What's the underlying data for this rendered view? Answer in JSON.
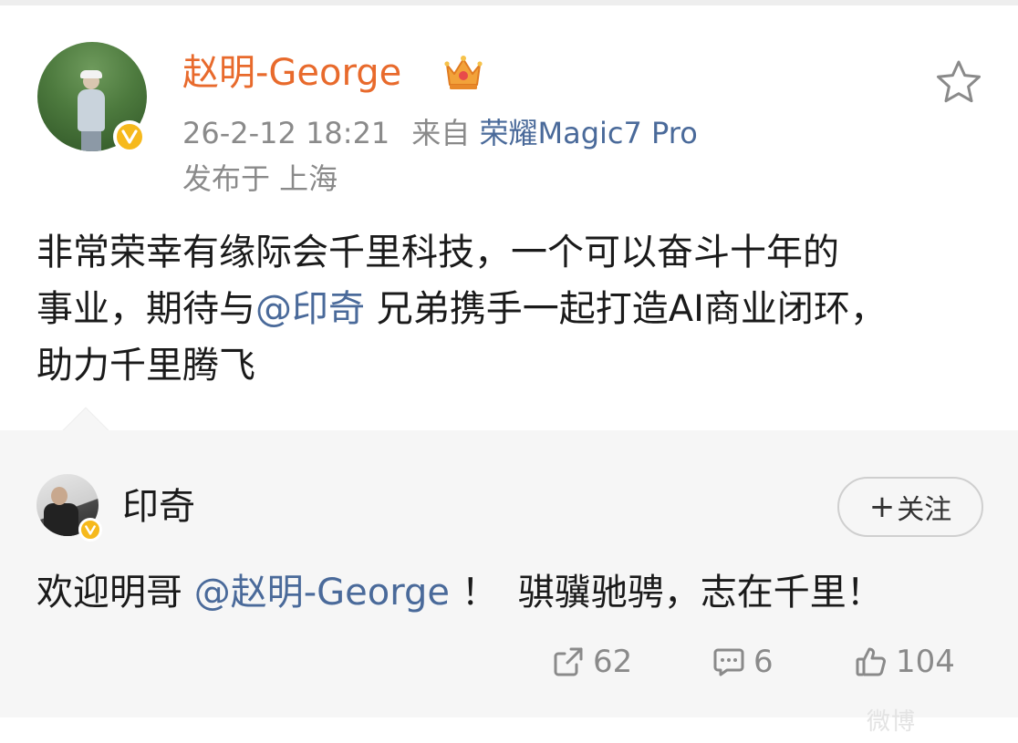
{
  "post": {
    "author": "赵明-George",
    "time": "26-2-12 18:21",
    "source_prefix": "来自",
    "source_device": "荣耀Magic7 Pro",
    "location": "发布于 上海",
    "body_line1": "非常荣幸有缘际会千里科技，一个可以奋斗十年的",
    "body_line2_a": "事业，期待与",
    "body_line2_mention": "@印奇",
    "body_line2_b": " 兄弟携手一起打造AI商业闭环，",
    "body_line3": "助力千里腾飞",
    "verified_badge": "verified-v-icon",
    "author_color": "#e86a2c",
    "mention_color": "#4a6a9a"
  },
  "repost": {
    "name": "印奇",
    "follow_label": "关注",
    "follow_plus": "+",
    "text_a": "欢迎明哥 ",
    "text_mention": "@赵明-George",
    "text_b": " ！",
    "text_c": "骐骥驰骋，志在千里！",
    "background": "#f6f6f6"
  },
  "actions": {
    "repost_count": "62",
    "comment_count": "6",
    "like_count": "104"
  },
  "watermark": {
    "text": "微博"
  }
}
